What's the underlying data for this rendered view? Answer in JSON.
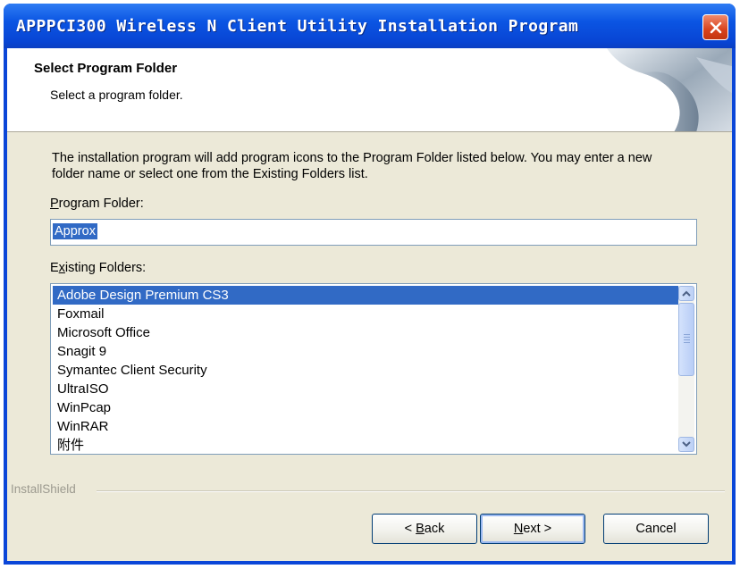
{
  "window": {
    "title": "APPPCI300 Wireless N Client Utility Installation Program"
  },
  "header": {
    "title": "Select Program Folder",
    "subtitle": "Select a program folder."
  },
  "description": "The installation program will add program icons to the Program Folder listed below. You may enter a new folder name or select one from the Existing Folders list.",
  "program_folder": {
    "label_accel": "P",
    "label_rest": "rogram Folder:",
    "value": "Approx"
  },
  "existing_folders": {
    "label_first": "E",
    "label_accel": "x",
    "label_rest": "isting Folders:",
    "items": [
      "Adobe Design Premium CS3",
      "Foxmail",
      "Microsoft Office",
      "Snagit 9",
      "Symantec Client Security",
      "UltraISO",
      "WinPcap",
      "WinRAR",
      "附件"
    ],
    "selected_index": 0
  },
  "brand": "InstallShield",
  "buttons": {
    "back_prefix": "< ",
    "back_accel": "B",
    "back_rest": "ack",
    "next_accel": "N",
    "next_rest": "ext >",
    "cancel": "Cancel"
  },
  "colors": {
    "titlebar": "#0b55e3",
    "selection": "#316ac5",
    "dialog_bg": "#ece9d8",
    "close_button": "#d9431d"
  }
}
